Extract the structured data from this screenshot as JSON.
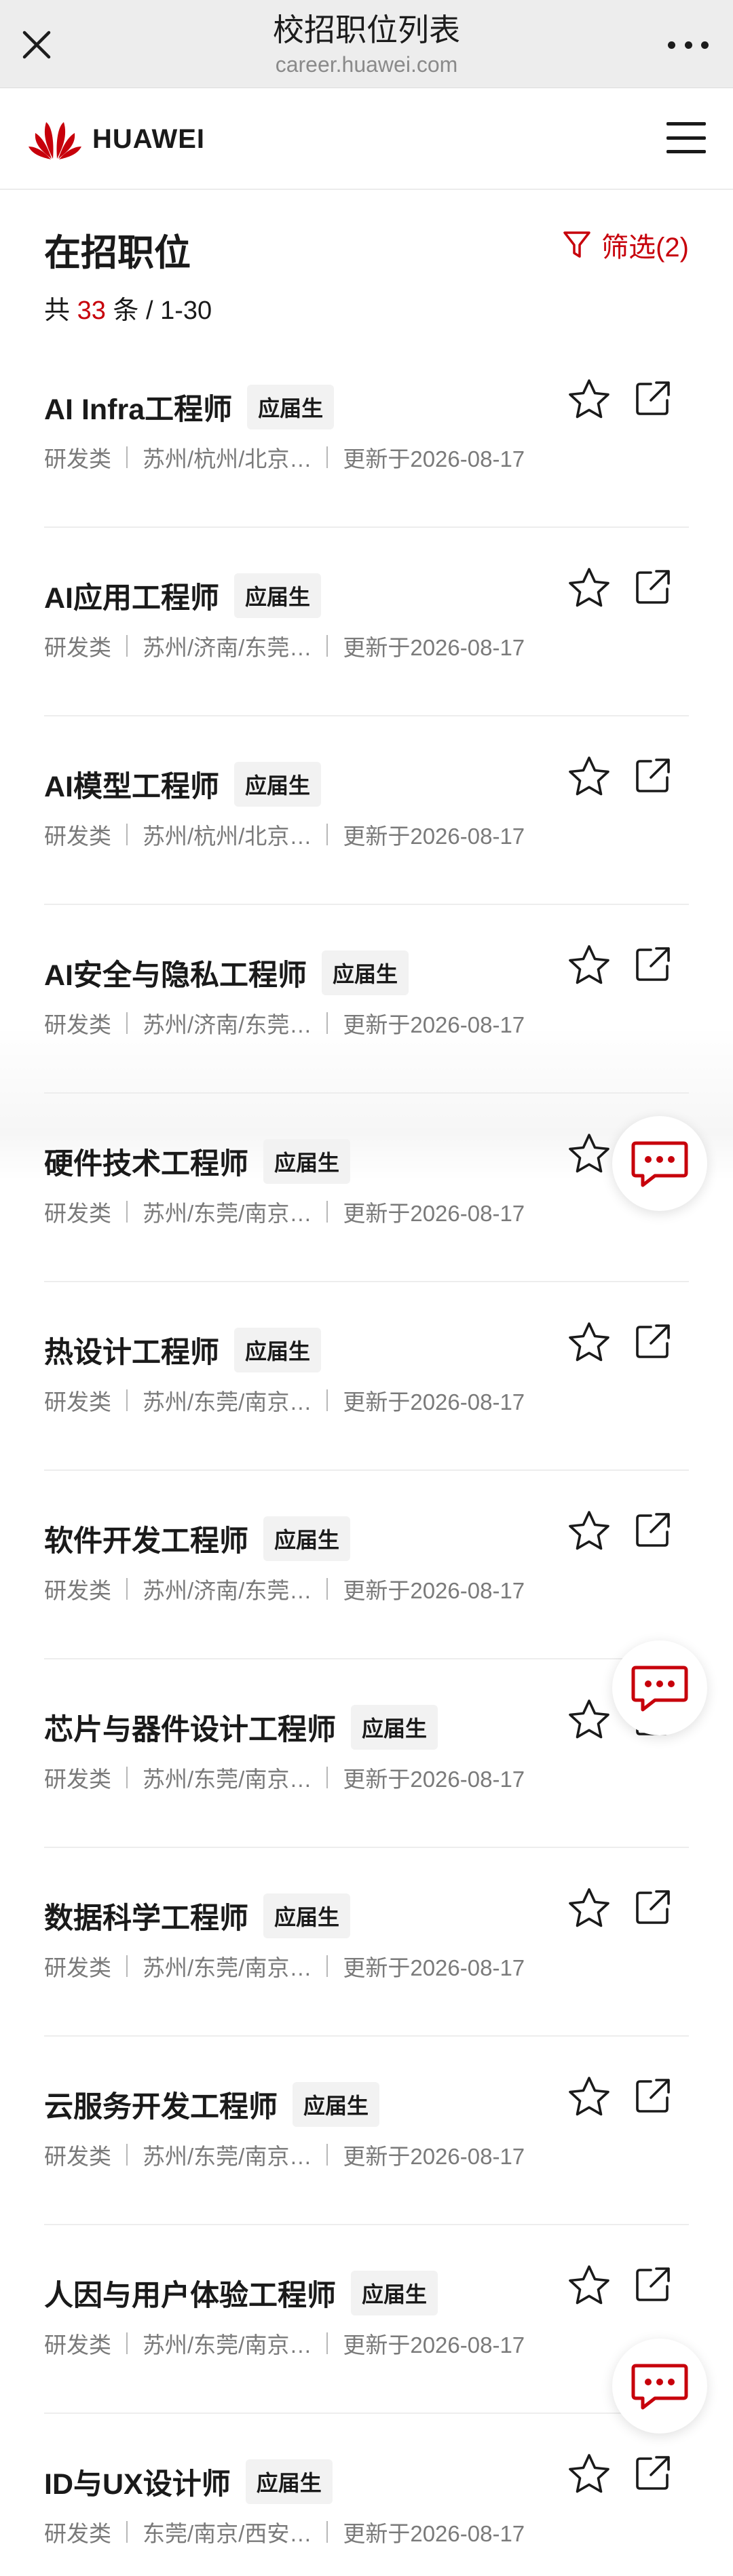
{
  "browser": {
    "title": "校招职位列表",
    "url": "career.huawei.com",
    "close_icon": "close-icon",
    "more_icon": "more-horizontal-icon"
  },
  "site": {
    "brand": "HUAWEI",
    "brand_color": "#c7000b",
    "menu_icon": "hamburger-menu-icon"
  },
  "list": {
    "title": "在招职位",
    "filter_label": "筛选(2)",
    "count_prefix": "共 ",
    "count": "33",
    "count_suffix": " 条 / 1-30"
  },
  "jobs": [
    {
      "title": "AI Infra工程师",
      "tag": "应届生",
      "category": "研发类",
      "locations": "苏州/杭州/北京…",
      "updated": "更新于2026-08-17"
    },
    {
      "title": "AI应用工程师",
      "tag": "应届生",
      "category": "研发类",
      "locations": "苏州/济南/东莞…",
      "updated": "更新于2026-08-17"
    },
    {
      "title": "AI模型工程师",
      "tag": "应届生",
      "category": "研发类",
      "locations": "苏州/杭州/北京…",
      "updated": "更新于2026-08-17"
    },
    {
      "title": "AI安全与隐私工程师",
      "tag": "应届生",
      "category": "研发类",
      "locations": "苏州/济南/东莞…",
      "updated": "更新于2026-08-17"
    },
    {
      "title": "硬件技术工程师",
      "tag": "应届生",
      "category": "研发类",
      "locations": "苏州/东莞/南京…",
      "updated": "更新于2026-08-17"
    },
    {
      "title": "热设计工程师",
      "tag": "应届生",
      "category": "研发类",
      "locations": "苏州/东莞/南京…",
      "updated": "更新于2026-08-17"
    },
    {
      "title": "软件开发工程师",
      "tag": "应届生",
      "category": "研发类",
      "locations": "苏州/济南/东莞…",
      "updated": "更新于2026-08-17"
    },
    {
      "title": "芯片与器件设计工程师",
      "tag": "应届生",
      "category": "研发类",
      "locations": "苏州/东莞/南京…",
      "updated": "更新于2026-08-17"
    },
    {
      "title": "数据科学工程师",
      "tag": "应届生",
      "category": "研发类",
      "locations": "苏州/东莞/南京…",
      "updated": "更新于2026-08-17"
    },
    {
      "title": "云服务开发工程师",
      "tag": "应届生",
      "category": "研发类",
      "locations": "苏州/东莞/南京…",
      "updated": "更新于2026-08-17"
    },
    {
      "title": "人因与用户体验工程师",
      "tag": "应届生",
      "category": "研发类",
      "locations": "苏州/东莞/南京…",
      "updated": "更新于2026-08-17"
    },
    {
      "title": "ID与UX设计师",
      "tag": "应届生",
      "category": "研发类",
      "locations": "东莞/南京/西安…",
      "updated": "更新于2026-08-17"
    }
  ],
  "icons": {
    "favorite": "star-outline-icon",
    "share": "share-external-icon",
    "chat": "chat-bubble-icon"
  }
}
